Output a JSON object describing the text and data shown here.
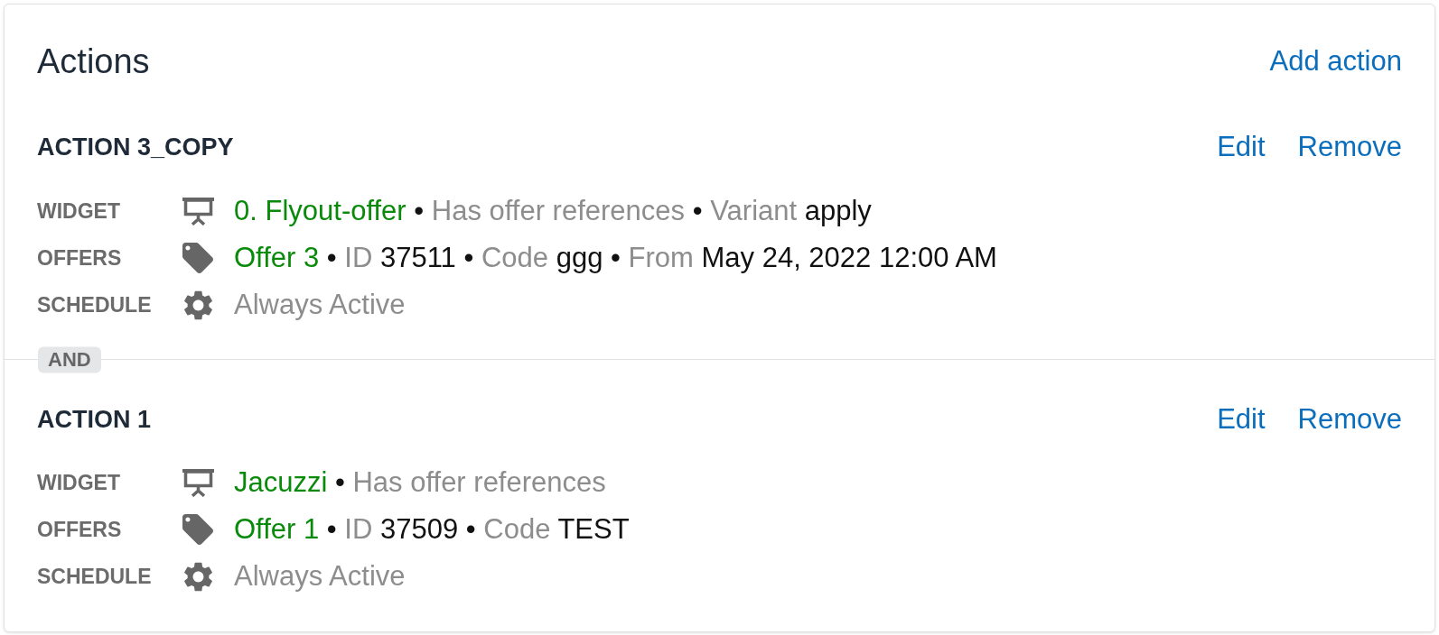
{
  "header": {
    "title": "Actions",
    "add_link": "Add action"
  },
  "actions": [
    {
      "title": "ACTION 3_COPY",
      "links": [
        "Edit",
        "Remove"
      ],
      "rows": [
        {
          "kind": "widget",
          "label": "WIDGET",
          "parts": [
            {
              "kind": "name",
              "text": "0. Flyout-offer"
            },
            {
              "kind": "bullet",
              "text": "•"
            },
            {
              "kind": "note",
              "text": "Has offer references"
            },
            {
              "kind": "bullet",
              "text": "•"
            },
            {
              "kind": "key",
              "text": "Variant"
            },
            {
              "kind": "value",
              "text": "apply"
            }
          ]
        },
        {
          "kind": "offers",
          "label": "OFFERS",
          "parts": [
            {
              "kind": "name",
              "text": "Offer 3"
            },
            {
              "kind": "bullet",
              "text": "•"
            },
            {
              "kind": "key",
              "text": "ID"
            },
            {
              "kind": "value",
              "text": "37511"
            },
            {
              "kind": "bullet",
              "text": "•"
            },
            {
              "kind": "key",
              "text": "Code"
            },
            {
              "kind": "value",
              "text": "ggg"
            },
            {
              "kind": "bullet",
              "text": "•"
            },
            {
              "kind": "key",
              "text": "From"
            },
            {
              "kind": "value",
              "text": "May 24, 2022 12:00 AM"
            }
          ]
        },
        {
          "kind": "schedule",
          "label": "SCHEDULE",
          "parts": [
            {
              "kind": "note",
              "text": "Always Active"
            }
          ]
        }
      ]
    },
    {
      "joined_by": "AND",
      "title": "ACTION 1",
      "links": [
        "Edit",
        "Remove"
      ],
      "rows": [
        {
          "kind": "widget",
          "label": "WIDGET",
          "parts": [
            {
              "kind": "name",
              "text": "Jacuzzi"
            },
            {
              "kind": "bullet",
              "text": "•"
            },
            {
              "kind": "note",
              "text": "Has offer references"
            }
          ]
        },
        {
          "kind": "offers",
          "label": "OFFERS",
          "parts": [
            {
              "kind": "name",
              "text": "Offer 1"
            },
            {
              "kind": "bullet",
              "text": "•"
            },
            {
              "kind": "key",
              "text": "ID"
            },
            {
              "kind": "value",
              "text": "37509"
            },
            {
              "kind": "bullet",
              "text": "•"
            },
            {
              "kind": "key",
              "text": "Code"
            },
            {
              "kind": "value",
              "text": "TEST"
            }
          ]
        },
        {
          "kind": "schedule",
          "label": "SCHEDULE",
          "parts": [
            {
              "kind": "note",
              "text": "Always Active"
            }
          ]
        }
      ]
    }
  ]
}
